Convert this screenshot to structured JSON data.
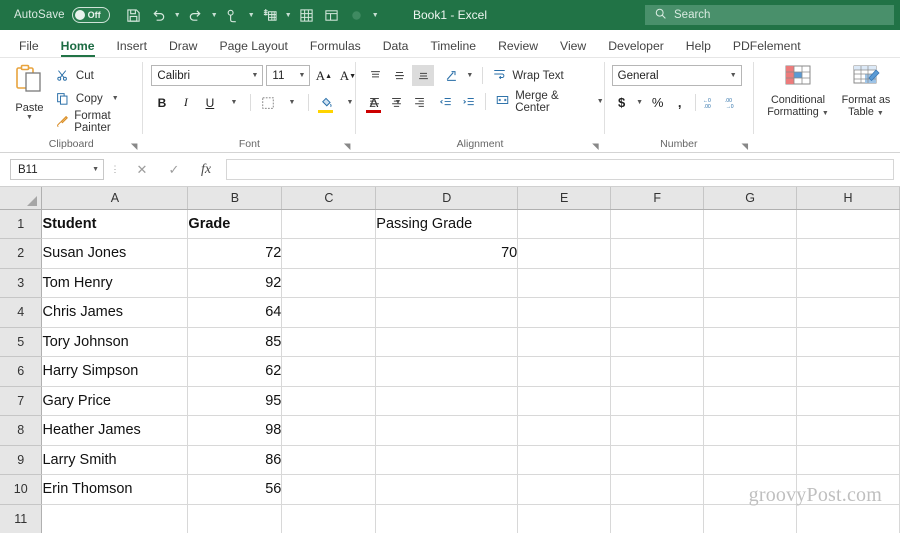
{
  "titlebar": {
    "autosave_label": "AutoSave",
    "autosave_state": "Off",
    "document_title": "Book1  -  Excel",
    "search_placeholder": "Search",
    "qat_icons": [
      "save-icon",
      "undo-icon",
      "redo-icon",
      "touch-mode-icon",
      "sort-filter-icon",
      "table-icon",
      "pivot-icon",
      "record-icon",
      "customize-qat-icon"
    ]
  },
  "tabs": [
    {
      "label": "File",
      "active": false
    },
    {
      "label": "Home",
      "active": true
    },
    {
      "label": "Insert",
      "active": false
    },
    {
      "label": "Draw",
      "active": false
    },
    {
      "label": "Page Layout",
      "active": false
    },
    {
      "label": "Formulas",
      "active": false
    },
    {
      "label": "Data",
      "active": false
    },
    {
      "label": "Timeline",
      "active": false
    },
    {
      "label": "Review",
      "active": false
    },
    {
      "label": "View",
      "active": false
    },
    {
      "label": "Developer",
      "active": false
    },
    {
      "label": "Help",
      "active": false
    },
    {
      "label": "PDFelement",
      "active": false
    }
  ],
  "ribbon": {
    "clipboard": {
      "group_label": "Clipboard",
      "paste_label": "Paste",
      "cut_label": "Cut",
      "copy_label": "Copy",
      "format_painter_label": "Format Painter"
    },
    "font": {
      "group_label": "Font",
      "font_name": "Calibri",
      "font_size": "11",
      "bold_label": "B",
      "italic_label": "I",
      "underline_label": "U",
      "grow_font_label": "A",
      "shrink_font_label": "A",
      "font_color_label": "A"
    },
    "alignment": {
      "group_label": "Alignment",
      "wrap_text_label": "Wrap Text",
      "merge_center_label": "Merge & Center"
    },
    "number": {
      "group_label": "Number",
      "format": "General",
      "currency_label": "$",
      "percent_label": "%",
      "comma_label": ","
    },
    "styles": {
      "conditional_formatting_label": "Conditional\nFormatting",
      "conditional_formatting_line1": "Conditional",
      "conditional_formatting_line2": "Formatting",
      "format_as_table_line1": "Format as",
      "format_as_table_line2": "Table"
    }
  },
  "formula_bar": {
    "name_box_value": "B11",
    "formula_value": "",
    "cancel_icon": "cancel-icon",
    "enter_icon": "check-icon",
    "function_icon": "fx-icon"
  },
  "sheet": {
    "columns": [
      "A",
      "B",
      "C",
      "D",
      "E",
      "F",
      "G",
      "H"
    ],
    "rows": [
      "1",
      "2",
      "3",
      "4",
      "5",
      "6",
      "7",
      "8",
      "9",
      "10",
      "11"
    ],
    "cells": [
      {
        "A": "Student",
        "B": "Grade",
        "C": "",
        "D": "Passing Grade",
        "E": "",
        "F": "",
        "G": "",
        "H": "",
        "bold": true
      },
      {
        "A": "Susan Jones",
        "B": "72",
        "C": "",
        "D": "70",
        "E": "",
        "F": "",
        "G": "",
        "H": "",
        "bold": false
      },
      {
        "A": "Tom Henry",
        "B": "92",
        "C": "",
        "D": "",
        "E": "",
        "F": "",
        "G": "",
        "H": "",
        "bold": false
      },
      {
        "A": "Chris James",
        "B": "64",
        "C": "",
        "D": "",
        "E": "",
        "F": "",
        "G": "",
        "H": "",
        "bold": false
      },
      {
        "A": "Tory Johnson",
        "B": "85",
        "C": "",
        "D": "",
        "E": "",
        "F": "",
        "G": "",
        "H": "",
        "bold": false
      },
      {
        "A": "Harry Simpson",
        "B": "62",
        "C": "",
        "D": "",
        "E": "",
        "F": "",
        "G": "",
        "H": "",
        "bold": false
      },
      {
        "A": "Gary Price",
        "B": "95",
        "C": "",
        "D": "",
        "E": "",
        "F": "",
        "G": "",
        "H": "",
        "bold": false
      },
      {
        "A": "Heather James",
        "B": "98",
        "C": "",
        "D": "",
        "E": "",
        "F": "",
        "G": "",
        "H": "",
        "bold": false
      },
      {
        "A": "Larry Smith",
        "B": "86",
        "C": "",
        "D": "",
        "E": "",
        "F": "",
        "G": "",
        "H": "",
        "bold": false
      },
      {
        "A": "Erin Thomson",
        "B": "56",
        "C": "",
        "D": "",
        "E": "",
        "F": "",
        "G": "",
        "H": "",
        "bold": false
      },
      {
        "A": "",
        "B": "",
        "C": "",
        "D": "",
        "E": "",
        "F": "",
        "G": "",
        "H": "",
        "bold": false
      }
    ],
    "watermark": "groovyPost.com"
  },
  "colors": {
    "brand_green": "#217346",
    "tab_active": "#1b6b42",
    "header_gray": "#e6e6e6",
    "gridline": "#d8d8d8"
  }
}
